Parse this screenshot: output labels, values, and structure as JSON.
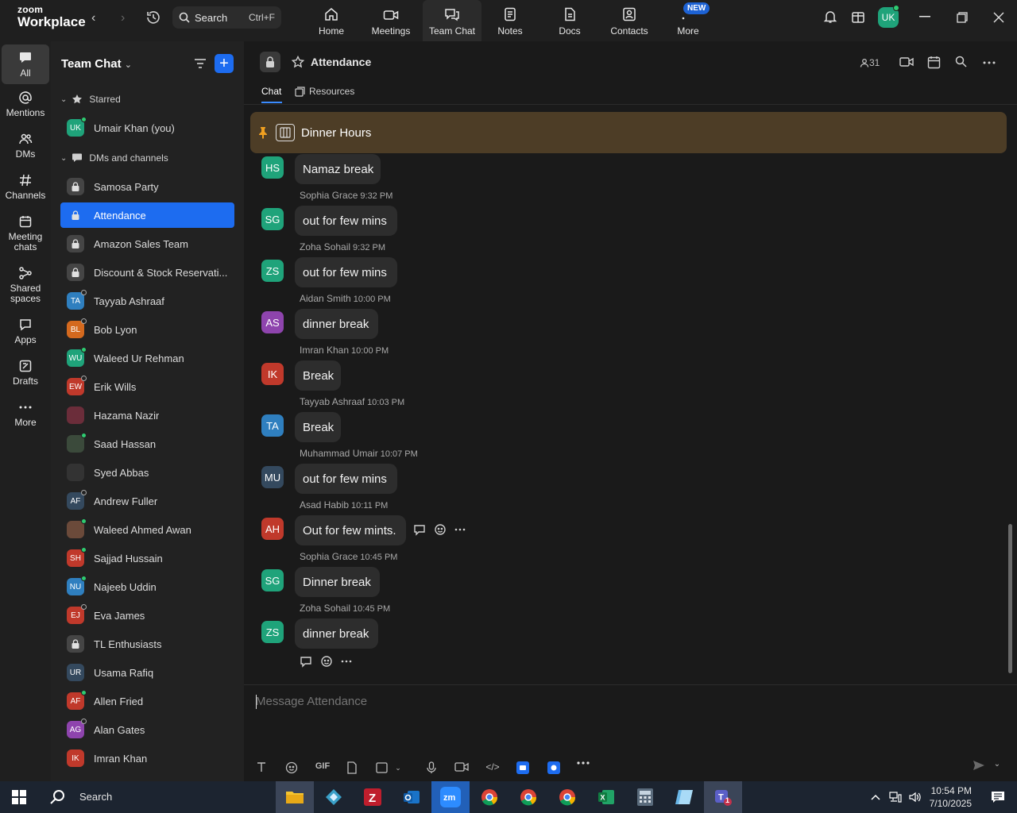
{
  "app": {
    "brand_small": "zoom",
    "brand_big": "Workplace",
    "search_label": "Search",
    "search_shortcut": "Ctrl+F",
    "nav_tabs": [
      {
        "label": "Home",
        "icon": "home-icon"
      },
      {
        "label": "Meetings",
        "icon": "video-camera-icon"
      },
      {
        "label": "Team Chat",
        "icon": "chat-bubbles-icon",
        "active": true
      },
      {
        "label": "Notes",
        "icon": "note-icon"
      },
      {
        "label": "Docs",
        "icon": "document-icon"
      },
      {
        "label": "Contacts",
        "icon": "contact-card-icon"
      },
      {
        "label": "More",
        "icon": "more-dots-icon"
      }
    ],
    "new_badge": "NEW",
    "user_initials": "UK",
    "accent": "#1d6cf0"
  },
  "rail": {
    "items": [
      {
        "label": "All",
        "icon": "chat-icon",
        "active": true
      },
      {
        "label": "Mentions",
        "icon": "at-icon"
      },
      {
        "label": "DMs",
        "icon": "people-icon"
      },
      {
        "label": "Channels",
        "icon": "hash-icon"
      },
      {
        "label": "Meeting chats",
        "icon": "calendar-icon"
      },
      {
        "label": "Shared spaces",
        "icon": "share-icon"
      },
      {
        "label": "Apps",
        "icon": "apps-icon"
      },
      {
        "label": "Drafts",
        "icon": "drafts-icon"
      },
      {
        "label": "More",
        "icon": "more-icon"
      }
    ]
  },
  "sidebar": {
    "title": "Team Chat",
    "starred_header": "Starred",
    "starred": [
      {
        "initials": "UK",
        "name": "Umair Khan (you)",
        "color": "#1fa37a",
        "status": "on"
      }
    ],
    "dms_header": "DMs and channels",
    "channels": [
      {
        "name": "Samosa Party",
        "type": "lock"
      },
      {
        "name": "Attendance",
        "type": "lock",
        "active": true
      },
      {
        "name": "Amazon Sales Team",
        "type": "lock"
      },
      {
        "name": "Discount & Stock Reservati...",
        "type": "lock"
      },
      {
        "initials": "TA",
        "name": "Tayyab Ashraaf",
        "color": "#2f7fbf",
        "status": "off"
      },
      {
        "initials": "BL",
        "name": "Bob Lyon",
        "color": "#d4691e",
        "status": "off"
      },
      {
        "initials": "WU",
        "name": "Waleed Ur Rehman",
        "color": "#1fa37a",
        "status": "on"
      },
      {
        "initials": "EW",
        "name": "Erik Wills",
        "color": "#c0392b",
        "status": "off"
      },
      {
        "initials": "",
        "name": "Hazama Nazir",
        "color": "#6b2d3a",
        "status": ""
      },
      {
        "initials": "",
        "name": "Saad Hassan",
        "color": "#3b4a3b",
        "status": "on"
      },
      {
        "initials": "",
        "name": "Syed Abbas",
        "color": "#333333",
        "status": ""
      },
      {
        "initials": "AF",
        "name": "Andrew Fuller",
        "color": "#34495e",
        "status": "off"
      },
      {
        "initials": "",
        "name": "Waleed Ahmed Awan",
        "color": "#6b4a3a",
        "status": "on"
      },
      {
        "initials": "SH",
        "name": "Sajjad Hussain",
        "color": "#c0392b",
        "status": "on"
      },
      {
        "initials": "NU",
        "name": "Najeeb Uddin",
        "color": "#2f7fbf",
        "status": "on"
      },
      {
        "initials": "EJ",
        "name": "Eva James",
        "color": "#c0392b",
        "status": "off"
      },
      {
        "name": "TL Enthusiasts",
        "type": "lock"
      },
      {
        "initials": "UR",
        "name": "Usama Rafiq",
        "color": "#34495e",
        "status": ""
      },
      {
        "initials": "AF",
        "name": "Allen Fried",
        "color": "#c0392b",
        "status": "on"
      },
      {
        "initials": "AG",
        "name": "Alan Gates",
        "color": "#8e44ad",
        "status": "off"
      },
      {
        "initials": "IK",
        "name": "Imran Khan",
        "color": "#c0392b",
        "status": ""
      }
    ]
  },
  "channel": {
    "title": "Attendance",
    "member_count": "31",
    "tabs": [
      "Chat",
      "Resources"
    ],
    "pinned_text": "Dinner Hours",
    "composer_placeholder": "Message Attendance"
  },
  "messages": [
    {
      "initials": "HS",
      "color": "#1fa37a",
      "sender": "",
      "time": "",
      "text": "Namaz break"
    },
    {
      "initials": "SG",
      "color": "#1fa37a",
      "sender": "Sophia Grace",
      "time": "9:32 PM",
      "text": "out for few mins"
    },
    {
      "initials": "ZS",
      "color": "#1fa37a",
      "sender": "Zoha Sohail",
      "time": "9:32 PM",
      "text": "out for few mins"
    },
    {
      "initials": "AS",
      "color": "#8e44ad",
      "sender": "Aidan Smith",
      "time": "10:00 PM",
      "text": "dinner break"
    },
    {
      "initials": "IK",
      "color": "#c0392b",
      "sender": "Imran Khan",
      "time": "10:00 PM",
      "text": "Break"
    },
    {
      "initials": "TA",
      "color": "#2f7fbf",
      "sender": "Tayyab Ashraaf",
      "time": "10:03 PM",
      "text": "Break"
    },
    {
      "initials": "MU",
      "color": "#34495e",
      "sender": "Muhammad Umair",
      "time": "10:07 PM",
      "text": "out for few mins"
    },
    {
      "initials": "AH",
      "color": "#c0392b",
      "sender": "Asad Habib",
      "time": "10:11 PM",
      "text": "Out for few mints."
    },
    {
      "initials": "SG",
      "color": "#1fa37a",
      "sender": "Sophia Grace",
      "time": "10:45 PM",
      "text": "Dinner break"
    },
    {
      "initials": "ZS",
      "color": "#1fa37a",
      "sender": "Zoha Sohail",
      "time": "10:45 PM",
      "text": "dinner break"
    }
  ],
  "composer_tools": [
    {
      "icon": "text-format-icon",
      "label": "T"
    },
    {
      "icon": "emoji-icon",
      "label": ""
    },
    {
      "icon": "gif-icon",
      "label": "GIF"
    },
    {
      "icon": "file-icon",
      "label": ""
    },
    {
      "icon": "screenshot-icon",
      "label": ""
    },
    {
      "icon": "microphone-icon",
      "label": ""
    },
    {
      "icon": "video-clip-icon",
      "label": ""
    },
    {
      "icon": "code-icon",
      "label": "</>"
    },
    {
      "icon": "app-blue-1-icon",
      "label": ""
    },
    {
      "icon": "app-blue-2-icon",
      "label": ""
    },
    {
      "icon": "more-icon",
      "label": ""
    }
  ],
  "taskbar": {
    "search_label": "Search",
    "time": "10:54 PM",
    "date": "7/10/2025",
    "teams_badge": "1"
  }
}
